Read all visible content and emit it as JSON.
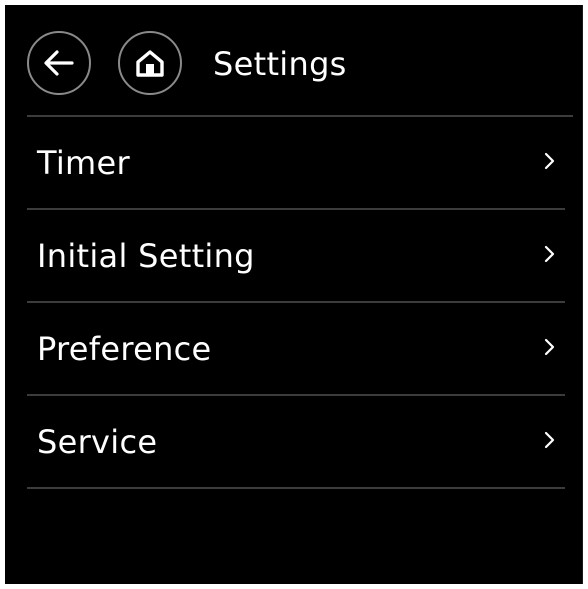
{
  "header": {
    "title": "Settings",
    "back_icon": "arrow-left-icon",
    "home_icon": "home-icon"
  },
  "menu": {
    "items": [
      {
        "label": "Timer",
        "icon": "chevron-right-icon"
      },
      {
        "label": "Initial Setting",
        "icon": "chevron-right-icon"
      },
      {
        "label": "Preference",
        "icon": "chevron-right-icon"
      },
      {
        "label": "Service",
        "icon": "chevron-right-icon"
      }
    ]
  },
  "colors": {
    "background": "#000000",
    "text": "#ffffff",
    "divider": "#3c3c3c",
    "button_border": "#8a8a8a"
  }
}
